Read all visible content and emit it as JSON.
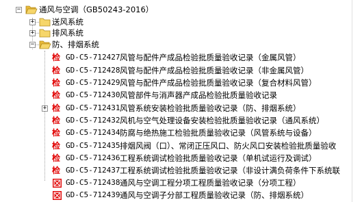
{
  "root": {
    "label": "通风与空调（GB50243-2016）",
    "toggle": "−"
  },
  "groups": [
    {
      "label": "送风系统",
      "toggle": "+"
    },
    {
      "label": "排风系统",
      "toggle": "+"
    },
    {
      "label": "防、排烟系统",
      "toggle": "−"
    }
  ],
  "check_glyph": "检",
  "records": [
    {
      "code": "GD-C5-712427",
      "title": "风管与配件产成品检验批质量验收记录（金属风管）",
      "icon": "jian",
      "toggle": ""
    },
    {
      "code": "GD-C5-712428",
      "title": "风管与配件产成品检验批质量验收记录（非金属风管）",
      "icon": "jian",
      "toggle": ""
    },
    {
      "code": "GD-C5-712429",
      "title": "风管与配件产成品检验批质量验收记录（复合材料风管）",
      "icon": "jian",
      "toggle": ""
    },
    {
      "code": "GD-C5-712430",
      "title": "风管部件与消声器产成品检验批质量验收记录",
      "icon": "jian",
      "toggle": ""
    },
    {
      "code": "GD-C5-712431",
      "title": "风管系统安装检验批质量验收记录（防、排烟系统）",
      "icon": "jian",
      "toggle": "+"
    },
    {
      "code": "GD-C5-712432",
      "title": "风机与空气处理设备安装检验批质量验收记录（通风系统）",
      "icon": "jian",
      "toggle": ""
    },
    {
      "code": "GD-C5-712434",
      "title": "防腐与绝热施工检验批质量验收记录（风管系统与设备）",
      "icon": "jian",
      "toggle": ""
    },
    {
      "code": "GD-C5-712435",
      "title": "排烟风阀（口）、常闭正压风口、防火风口安装检验批质量验收",
      "icon": "jian",
      "toggle": ""
    },
    {
      "code": "GD-C5-712436",
      "title": "工程系统调试检验批质量验收记录（单机试运行及调试）",
      "icon": "jian",
      "toggle": ""
    },
    {
      "code": "GD-C5-712437",
      "title": "工程系统调试检验批质量验收记录（非设计满负荷条件下系统联",
      "icon": "jian",
      "toggle": ""
    },
    {
      "code": "GD-C5-712438",
      "title": "通风与空调工程分项工程质量验收记录（分项工程）",
      "icon": "red-box-icon",
      "toggle": ""
    },
    {
      "code": "GD-C5-712439",
      "title": "通风与空调子分部工程质量验收记录（防、排烟系统）",
      "icon": "red-box-icon",
      "toggle": ""
    }
  ],
  "colors": {
    "check_red": "#e00000",
    "folder_yellow": "#f2c94c",
    "folder_edge": "#c9a227"
  }
}
